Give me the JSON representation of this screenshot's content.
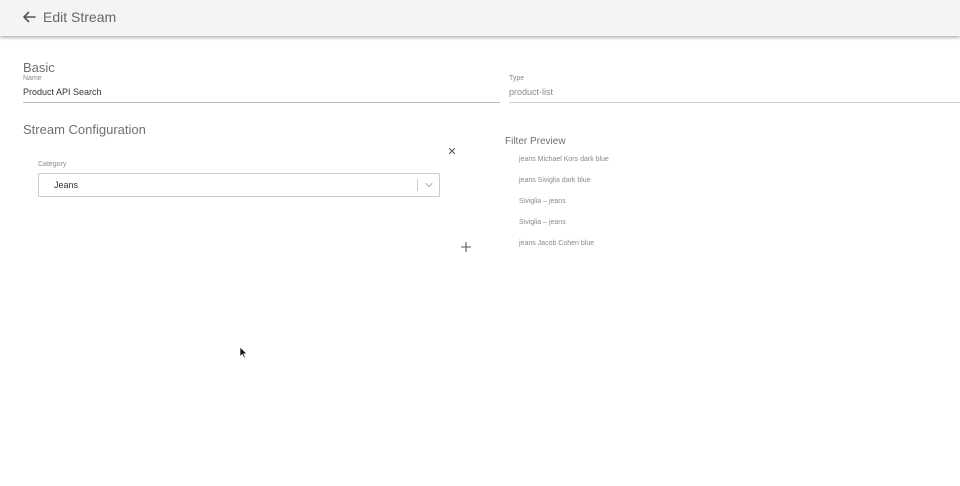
{
  "header": {
    "title": "Edit Stream",
    "back_icon": "arrow-left-icon"
  },
  "basic": {
    "section_title": "Basic",
    "name_label": "Name",
    "name_value": "Product API Search",
    "type_label": "Type",
    "type_value": "product-list"
  },
  "stream_config": {
    "section_title": "Stream Configuration",
    "remove_icon": "close-icon",
    "category_label": "Category",
    "category_value": "Jeans",
    "dropdown_icon": "chevron-down-icon",
    "add_icon": "plus-icon"
  },
  "filter_preview": {
    "title": "Filter Preview",
    "items": [
      "jeans Michael Kors dark blue",
      "jeans Siviglia dark blue",
      "Siviglia – jeans",
      "Siviglia – jeans",
      "jeans Jacob Cohen blue"
    ]
  }
}
